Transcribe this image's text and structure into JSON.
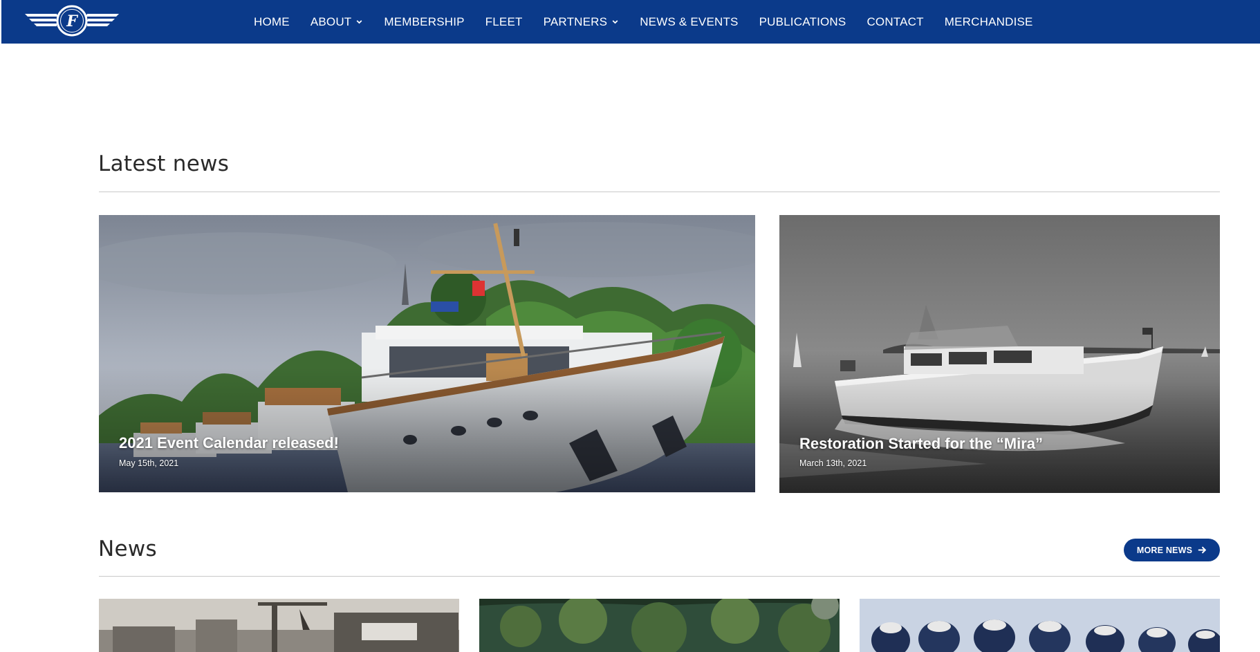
{
  "nav": {
    "logo_letter": "F",
    "items": [
      {
        "label": "HOME",
        "has_dropdown": false
      },
      {
        "label": "ABOUT",
        "has_dropdown": true
      },
      {
        "label": "MEMBERSHIP",
        "has_dropdown": false
      },
      {
        "label": "FLEET",
        "has_dropdown": false
      },
      {
        "label": "PARTNERS",
        "has_dropdown": true
      },
      {
        "label": "NEWS & EVENTS",
        "has_dropdown": false
      },
      {
        "label": "PUBLICATIONS",
        "has_dropdown": false
      },
      {
        "label": "CONTACT",
        "has_dropdown": false
      },
      {
        "label": "MERCHANDISE",
        "has_dropdown": false
      }
    ]
  },
  "latest": {
    "title": "Latest news",
    "cards": [
      {
        "title": "2021 Event Calendar released!",
        "date": "May 15th, 2021",
        "image": "yacht-fleet-photo"
      },
      {
        "title": "Restoration Started for the “Mira”",
        "date": "March 13th, 2021",
        "image": "vintage-motorboat-photo"
      }
    ]
  },
  "news": {
    "title": "News",
    "more_label": "MORE NEWS",
    "thumbs": [
      {
        "image": "shipyard-vintage-photo"
      },
      {
        "image": "forested-lake-photo"
      },
      {
        "image": "crew-in-caps-photo"
      }
    ]
  },
  "colors": {
    "brand_blue": "#0b3a8a",
    "rule_gray": "#c9c9c9",
    "heading_text": "#2a2a2a"
  }
}
